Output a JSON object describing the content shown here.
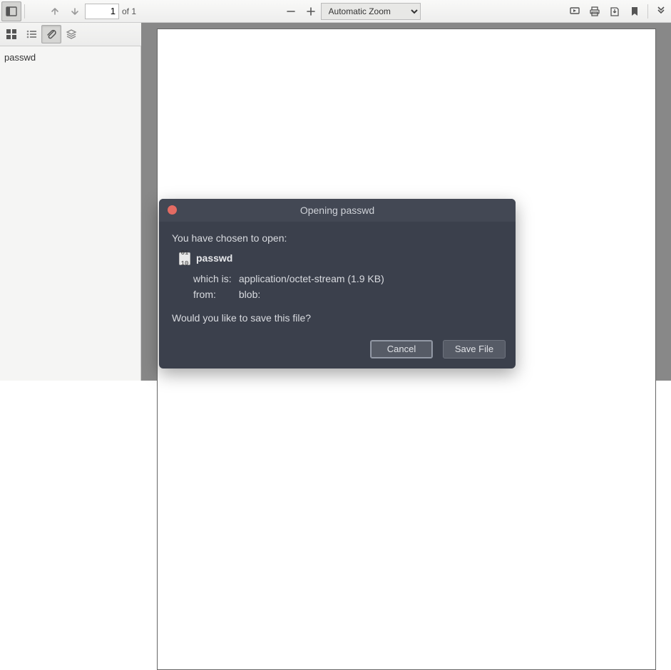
{
  "toolbar": {
    "page_input_value": "1",
    "page_of_label": "of 1",
    "zoom_selected": "Automatic Zoom"
  },
  "sidebar": {
    "attachment_name": "passwd"
  },
  "dialog": {
    "title": "Opening passwd",
    "intro": "You have chosen to open:",
    "file_name": "passwd",
    "which_is_label": "which is:",
    "which_is_value": "application/octet-stream (1.9 KB)",
    "from_label": "from:",
    "from_value": "blob:",
    "question": "Would you like to save this file?",
    "cancel_label": "Cancel",
    "save_label": "Save File"
  }
}
